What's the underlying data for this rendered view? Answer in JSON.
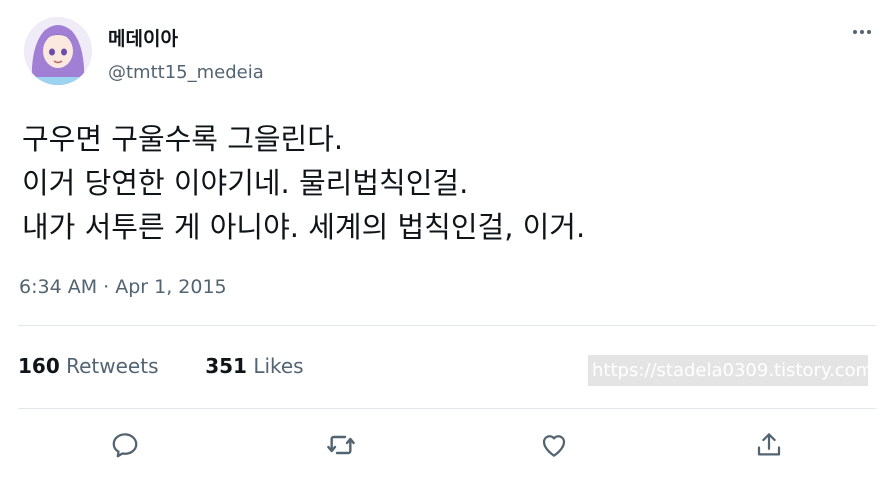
{
  "tweet": {
    "display_name": "메데이아",
    "handle": "@tmtt15_medeia",
    "text_lines": [
      "구우면 구울수록 그을린다.",
      "이거 당연한 이야기네. 물리법칙인걸.",
      "내가 서투른 게 아니야. 세계의 법칙인걸, 이거."
    ],
    "timestamp": "6:34 AM · Apr 1, 2015",
    "retweets_count": "160",
    "retweets_label": "Retweets",
    "likes_count": "351",
    "likes_label": "Likes"
  },
  "watermark": "https://stadela0309.tistory.com",
  "icons": {
    "more": "more-horizontal-icon",
    "reply": "reply-icon",
    "retweet": "retweet-icon",
    "like": "like-icon",
    "share": "share-icon"
  },
  "colors": {
    "text_primary": "#0f1419",
    "text_secondary": "#536471",
    "divider": "#e1e6ea",
    "icon": "#536471",
    "avatar_hair": "#a07fd4"
  }
}
